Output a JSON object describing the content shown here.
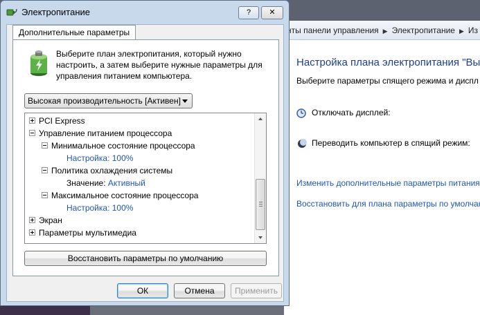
{
  "dialog": {
    "title": "Электропитание",
    "help_label": "?",
    "close_label": "✕",
    "tab_label": "Дополнительные параметры",
    "intro_text": "Выберите план электропитания, который нужно настроить, а затем выберите нужные параметры для управления питанием компьютера.",
    "plan_select_value": "Высокая производительность [Активен]",
    "tree": [
      {
        "label": "PCI Express",
        "expander": "plus"
      },
      {
        "label": "Управление питанием процессора",
        "expander": "minus"
      },
      {
        "label": "Минимальное состояние процессора",
        "expander": "minus"
      },
      {
        "label": "Настройка: 100%",
        "expander": "none"
      },
      {
        "label": "Политика охлаждения системы",
        "expander": "minus"
      },
      {
        "label": "Значение:",
        "value": "Активный",
        "expander": "none"
      },
      {
        "label": "Максимальное состояние процессора",
        "expander": "minus"
      },
      {
        "label": "Настройка: 100%",
        "expander": "none"
      },
      {
        "label": "Экран",
        "expander": "plus"
      },
      {
        "label": "Параметры мультимедиа",
        "expander": "plus"
      }
    ],
    "restore_defaults_label": "Восстановить параметры по умолчанию",
    "ok_label": "ОК",
    "cancel_label": "Отмена",
    "apply_label": "Применить"
  },
  "background_window": {
    "breadcrumb": [
      "нты панели управления",
      "Электропитание",
      "Из"
    ],
    "title": "Настройка плана электропитания \"Вы",
    "subtitle": "Выберите параметры спящего режима и диспл",
    "display_off_label": "Отключать дисплей:",
    "sleep_label": "Переводить компьютер в спящий режим:",
    "link_advanced": "Изменить дополнительные параметры питания",
    "link_restore": "Восстановить для плана параметры по умолчан"
  },
  "colors": {
    "link": "#1e56b8",
    "title": "#1e3d8f",
    "dialog_frame": "#c8d9ec"
  }
}
